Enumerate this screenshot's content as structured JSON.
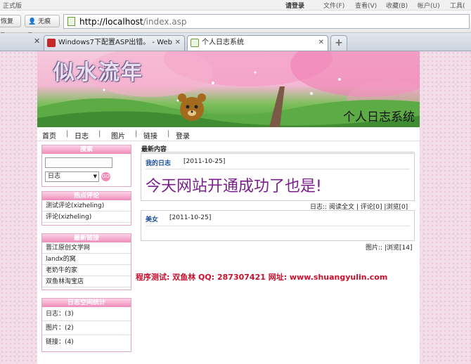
{
  "browser": {
    "menubar": {
      "edition": "正式版",
      "login": "请登录",
      "file": "文件(F)",
      "view": "查看(V)",
      "favorites": "收藏(B)",
      "account": "帐户(U)",
      "tools": "工具("
    },
    "nav": {
      "restore": "恢复",
      "traceless": "无痕"
    },
    "address": {
      "url_host": "http://localhost",
      "url_path": "/index.asp"
    },
    "tabs": [
      {
        "label": "Windows7下配置ASP出错。 - Web ..."
      },
      {
        "label": "个人日志系统"
      }
    ],
    "new_tab": "+"
  },
  "site": {
    "name": "个人日志系统",
    "logo_text": "似水流年",
    "nav": [
      "首页",
      "日志",
      "图片",
      "链接",
      "登录"
    ]
  },
  "sidebar": {
    "search": {
      "title": "搜索",
      "select_value": "日志"
    },
    "hot_comments": {
      "title": "热点评论",
      "items": [
        "测试评论(xizheling)",
        "评论(xizheling)"
      ]
    },
    "links": {
      "title": "最新链接",
      "items": [
        "晋江原创文学网",
        "landx的窝",
        "老奶牛的家",
        "双鱼林淘宝店"
      ]
    },
    "stats": {
      "title": "日志空间统计",
      "items": [
        "日志：(3)",
        "图片：(2)",
        "链接：(4)"
      ]
    }
  },
  "main": {
    "section_title": "最新内容",
    "post1": {
      "category": "我的日志",
      "date": "[2011-10-25]",
      "body": "今天网站开通成功了也是!",
      "footer_type": "日志::",
      "read_more": "阅读全文",
      "comments": "评论[0]",
      "views": "浏览[0]"
    },
    "post2": {
      "category": "美女",
      "date": "[2011-10-25]",
      "footer_type": "图片::",
      "views": "浏览[14]"
    },
    "credits": "程序测试: 双鱼林  QQ: 287307421  网址: www.shuangyulin.com"
  },
  "colors": {
    "accent_pink": "#f08bba",
    "post_purple": "#7a1f8c",
    "credit_red": "#c8102e",
    "link_blue": "#1a4f9a"
  }
}
